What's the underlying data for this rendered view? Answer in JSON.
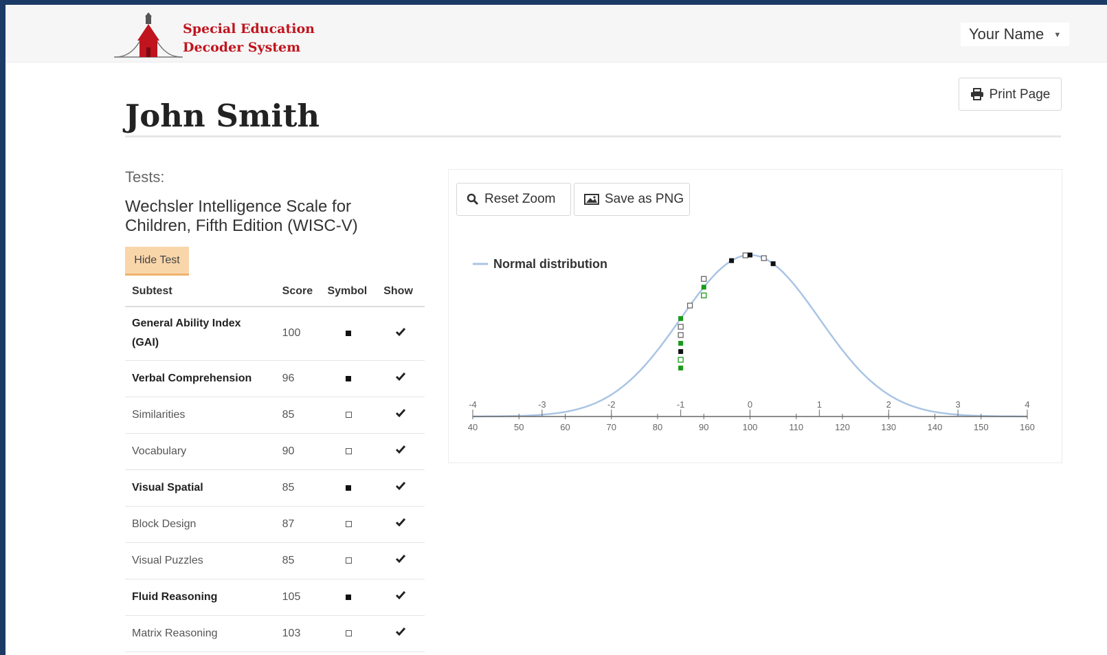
{
  "brand": {
    "line1": "Special Education",
    "line2": "Decoder System"
  },
  "user_menu": {
    "label": "Your Name"
  },
  "print_button": {
    "label": "Print Page"
  },
  "student": {
    "name": "John Smith"
  },
  "tests": {
    "label": "Tests:",
    "test_name": "Wechsler Intelligence Scale for Children, Fifth Edition (WISC-V)",
    "hide_button": "Hide Test",
    "columns": [
      "Subtest",
      "Score",
      "Symbol",
      "Show"
    ],
    "rows": [
      {
        "label": "General Ability Index (GAI)",
        "score": "100",
        "symbol": "filled",
        "show": true,
        "kind": "index"
      },
      {
        "label": "Verbal Comprehension",
        "score": "96",
        "symbol": "filled",
        "show": true,
        "kind": "index"
      },
      {
        "label": "Similarities",
        "score": "85",
        "symbol": "open",
        "show": true,
        "kind": "sub"
      },
      {
        "label": "Vocabulary",
        "score": "90",
        "symbol": "open",
        "show": true,
        "kind": "sub"
      },
      {
        "label": "Visual Spatial",
        "score": "85",
        "symbol": "filled",
        "show": true,
        "kind": "index"
      },
      {
        "label": "Block Design",
        "score": "87",
        "symbol": "open",
        "show": true,
        "kind": "sub"
      },
      {
        "label": "Visual Puzzles",
        "score": "85",
        "symbol": "open",
        "show": true,
        "kind": "sub"
      },
      {
        "label": "Fluid Reasoning",
        "score": "105",
        "symbol": "filled",
        "show": true,
        "kind": "index"
      },
      {
        "label": "Matrix Reasoning",
        "score": "103",
        "symbol": "open",
        "show": true,
        "kind": "sub"
      }
    ]
  },
  "chart_toolbar": {
    "reset_zoom": "Reset Zoom",
    "save_png": "Save as PNG"
  },
  "colors": {
    "curve": "#a9c4e4",
    "marker_green": "#1a9a1a",
    "brand_red": "#c0141e"
  },
  "chart_data": {
    "type": "line",
    "legend": {
      "label": "Normal distribution",
      "placement": "top-left"
    },
    "x_axis": {
      "range": [
        40,
        160
      ],
      "ticks": [
        40,
        50,
        60,
        70,
        80,
        90,
        100,
        110,
        120,
        130,
        140,
        150,
        160
      ],
      "sd_ticks": [
        {
          "score": 40,
          "label": "-4"
        },
        {
          "score": 55,
          "label": "-3"
        },
        {
          "score": 70,
          "label": "-2"
        },
        {
          "score": 85,
          "label": "-1"
        },
        {
          "score": 100,
          "label": "0"
        },
        {
          "score": 115,
          "label": "1"
        },
        {
          "score": 130,
          "label": "2"
        },
        {
          "score": 145,
          "label": "3"
        },
        {
          "score": 160,
          "label": "4"
        }
      ]
    },
    "series": [
      {
        "name": "Normal distribution",
        "distribution": "normal",
        "mean": 100,
        "sd": 15
      }
    ],
    "points": [
      {
        "score": 85,
        "offset": 0,
        "symbol": "filled",
        "color": "green"
      },
      {
        "score": 85,
        "offset": 1,
        "symbol": "open",
        "color": "gray"
      },
      {
        "score": 85,
        "offset": 2,
        "symbol": "open",
        "color": "gray"
      },
      {
        "score": 85,
        "offset": 3,
        "symbol": "filled",
        "color": "green"
      },
      {
        "score": 85,
        "offset": 4,
        "symbol": "filled",
        "color": "black"
      },
      {
        "score": 85,
        "offset": 5,
        "symbol": "open",
        "color": "green"
      },
      {
        "score": 85,
        "offset": 6,
        "symbol": "filled",
        "color": "green"
      },
      {
        "score": 87,
        "offset": 0,
        "symbol": "open",
        "color": "gray"
      },
      {
        "score": 90,
        "offset": -1,
        "symbol": "open",
        "color": "gray"
      },
      {
        "score": 90,
        "offset": 0,
        "symbol": "filled",
        "color": "green"
      },
      {
        "score": 90,
        "offset": 1,
        "symbol": "open",
        "color": "green"
      },
      {
        "score": 96,
        "offset": 0,
        "symbol": "filled",
        "color": "black"
      },
      {
        "score": 99,
        "offset": 0,
        "symbol": "open",
        "color": "gray"
      },
      {
        "score": 100,
        "offset": 0,
        "symbol": "filled",
        "color": "black"
      },
      {
        "score": 103,
        "offset": 0,
        "symbol": "open",
        "color": "gray"
      },
      {
        "score": 105,
        "offset": 0,
        "symbol": "filled",
        "color": "black"
      }
    ]
  }
}
